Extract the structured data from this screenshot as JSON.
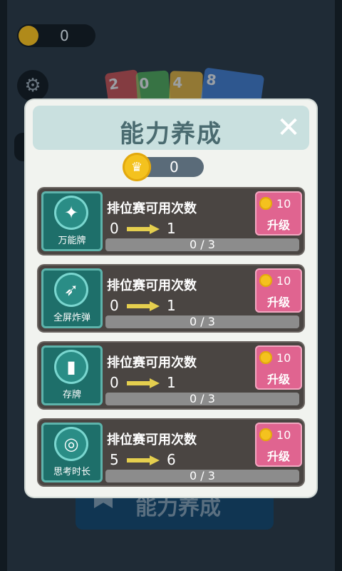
{
  "background": {
    "coin_value": "0",
    "bottom_button_label": "能力养成",
    "cards": [
      {
        "label": "2",
        "color": "#d84b4b"
      },
      {
        "label": "0",
        "color": "#4caf50"
      },
      {
        "label": "4",
        "color": "#f1b734"
      },
      {
        "label": "8",
        "color": "#3b7bd8"
      }
    ]
  },
  "modal": {
    "title": "能力养成",
    "close_symbol": "✕",
    "coin_value": "0",
    "rows": [
      {
        "icon_label": "万能牌",
        "title": "排位赛可用次数",
        "from": "0",
        "to": "1",
        "progress_text": "0 / 3",
        "progress_fraction": 0,
        "cost": "10",
        "button_label": "升级",
        "icon_glyph": "✦"
      },
      {
        "icon_label": "全屏炸弹",
        "title": "排位赛可用次数",
        "from": "0",
        "to": "1",
        "progress_text": "0 / 3",
        "progress_fraction": 0,
        "cost": "10",
        "button_label": "升级",
        "icon_glyph": "➶"
      },
      {
        "icon_label": "存牌",
        "title": "排位赛可用次数",
        "from": "0",
        "to": "1",
        "progress_text": "0 / 3",
        "progress_fraction": 0,
        "cost": "10",
        "button_label": "升级",
        "icon_glyph": "▮"
      },
      {
        "icon_label": "思考时长",
        "title": "排位赛可用次数",
        "from": "5",
        "to": "6",
        "progress_text": "0 / 3",
        "progress_fraction": 0,
        "cost": "10",
        "button_label": "升级",
        "icon_glyph": "◎"
      }
    ]
  },
  "colors": {
    "header_bg": "#c9e0df",
    "title_text": "#4a6b70",
    "upgrade_bg": "#e06490",
    "row_bg": "#4a4542",
    "coin_gold": "#f4c21e",
    "progress_bg": "#8c8c8c"
  }
}
